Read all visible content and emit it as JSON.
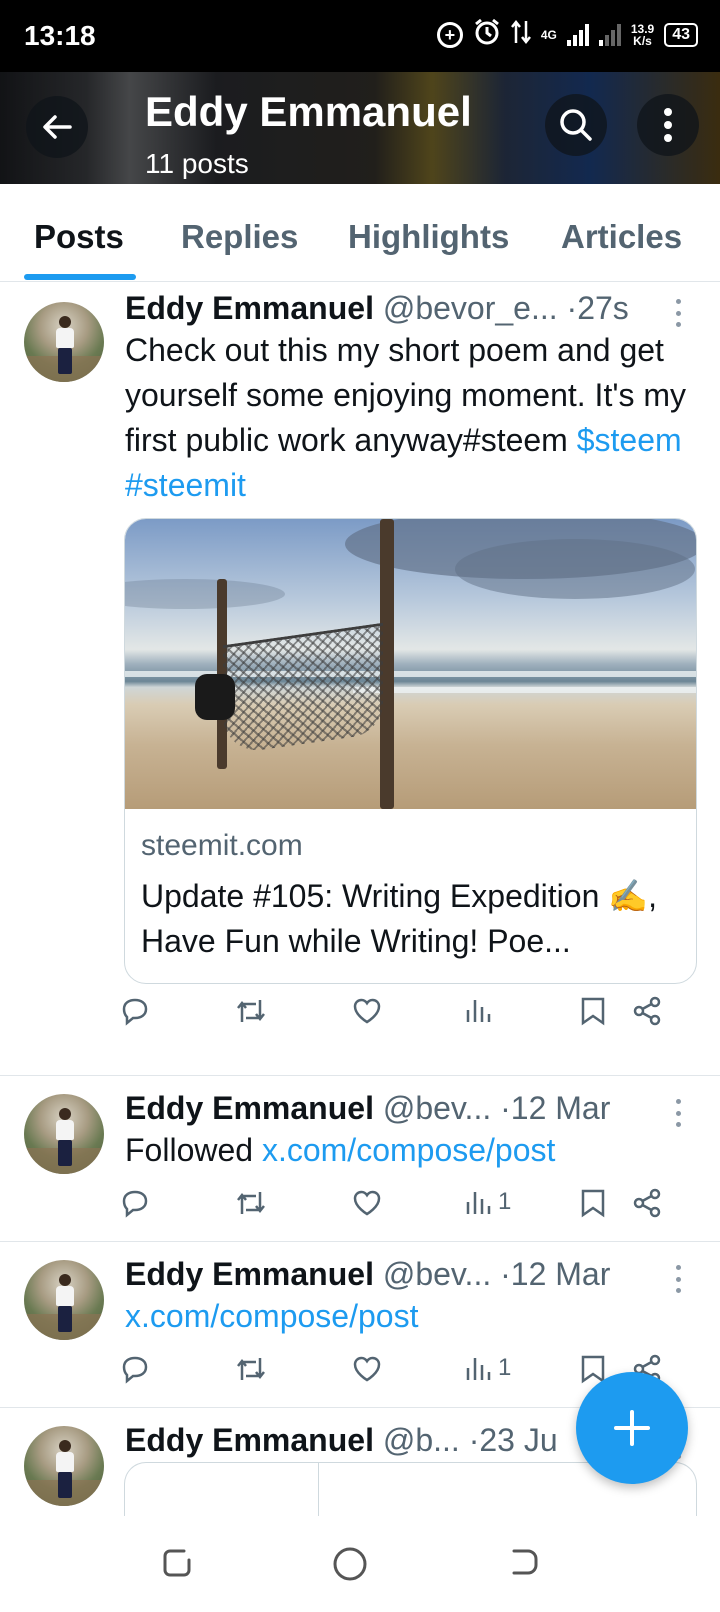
{
  "status_bar": {
    "time": "13:18",
    "network_type": "4G",
    "speed_value": "13.9",
    "speed_unit": "K/s",
    "battery": "43"
  },
  "header": {
    "title": "Eddy Emmanuel",
    "subtitle": "11 posts"
  },
  "tabs": [
    {
      "label": "Posts",
      "active": true
    },
    {
      "label": "Replies",
      "active": false
    },
    {
      "label": "Highlights",
      "active": false
    },
    {
      "label": "Articles",
      "active": false
    }
  ],
  "posts": [
    {
      "name": "Eddy Emmanuel",
      "handle": "@bevor_e...",
      "time": "27s",
      "text_plain": "Check out this my short poem and get yourself some enjoying moment. It's my first public work anyway#steem ",
      "text_link_1": "$steem",
      "text_link_2": "#steemit",
      "card": {
        "domain": "steemit.com",
        "title": "Update #105: Writing Expedition ✍️, Have Fun while Writing! Poe..."
      },
      "views": ""
    },
    {
      "name": "Eddy Emmanuel",
      "handle": "@bev...",
      "time": "12 Mar",
      "text_plain": "Followed ",
      "text_link": "x.com/compose/post",
      "views": "1"
    },
    {
      "name": "Eddy Emmanuel",
      "handle": "@bev...",
      "time": "12 Mar",
      "text_link": "x.com/compose/post",
      "views": "1"
    },
    {
      "name": "Eddy Emmanuel",
      "handle": "@b...",
      "time": "23 Ju"
    }
  ],
  "colors": {
    "accent": "#1d9bf0",
    "text": "#0f1419",
    "muted": "#536471",
    "divider": "#e1e6ea"
  },
  "icons": {
    "back": "arrow-left-icon",
    "search": "search-icon",
    "more": "more-vertical-icon",
    "reply": "reply-icon",
    "repost": "repost-icon",
    "like": "heart-icon",
    "views": "views-icon",
    "bookmark": "bookmark-icon",
    "share": "share-icon",
    "compose": "plus-icon"
  }
}
